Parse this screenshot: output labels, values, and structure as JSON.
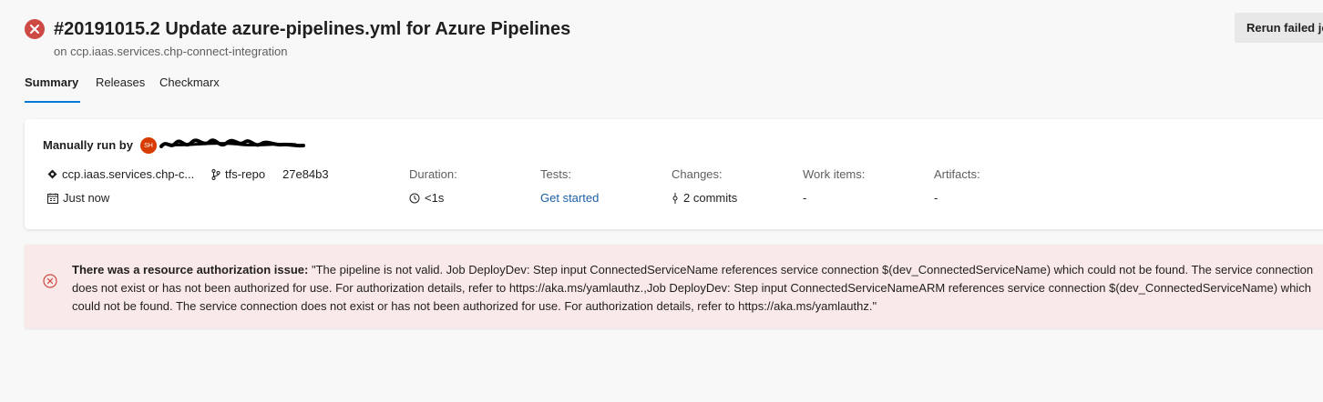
{
  "header": {
    "title": "#20191015.2 Update azure-pipelines.yml for Azure Pipelines",
    "subtitle": "on ccp.iaas.services.chp-connect-integration",
    "rerun_label": "Rerun failed jobs"
  },
  "tabs": [
    {
      "label": "Summary",
      "active": true
    },
    {
      "label": "Releases",
      "active": false
    },
    {
      "label": "Checkmarx",
      "active": false
    }
  ],
  "summary": {
    "run_by_label": "Manually run by",
    "avatar_initials": "SH",
    "repo": "ccp.iaas.services.chp-c...",
    "branch": "tfs-repo",
    "commit": "27e84b3",
    "time": "Just now",
    "duration_label": "Duration:",
    "duration_value": "<1s",
    "tests_label": "Tests:",
    "tests_value": "Get started",
    "changes_label": "Changes:",
    "changes_value": "2 commits",
    "work_items_label": "Work items:",
    "work_items_value": "-",
    "artifacts_label": "Artifacts:",
    "artifacts_value": "-"
  },
  "error": {
    "heading": "There was a resource authorization issue:",
    "message": "\"The pipeline is not valid. Job DeployDev: Step input ConnectedServiceName references service connection $(dev_ConnectedServiceName) which could not be found. The service connection does not exist or has not been authorized for use. For authorization details, refer to https://aka.ms/yamlauthz.,Job DeployDev: Step input ConnectedServiceNameARM references service connection $(dev_ConnectedServiceName) which could not be found. The service connection does not exist or has not been authorized for use. For authorization details, refer to https://aka.ms/yamlauthz.\""
  },
  "colors": {
    "failed": "#cd4a45",
    "accent": "#0078d4",
    "link": "#1d5fa8",
    "error_bg": "#f9e9e9"
  },
  "icons": [
    "failed-status-icon",
    "repo-icon",
    "branch-icon",
    "calendar-icon",
    "clock-icon",
    "commit-icon",
    "error-circle-icon"
  ]
}
